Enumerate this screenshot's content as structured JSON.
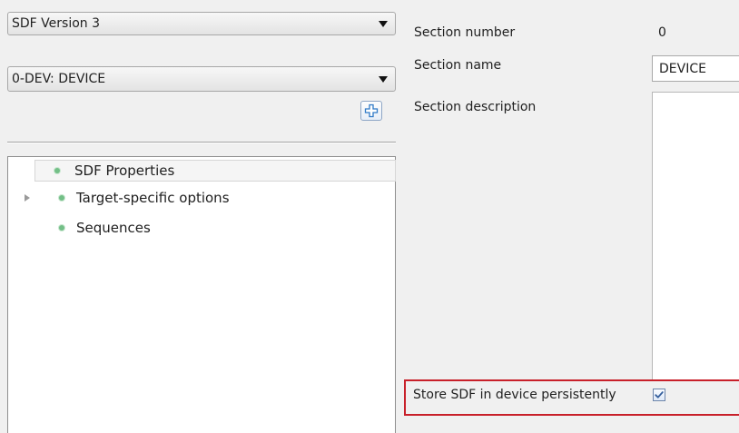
{
  "left_pane": {
    "version_combo": {
      "value": "SDF Version 3",
      "icon": "chevron-down-icon"
    },
    "section_combo": {
      "value": "0-DEV: DEVICE",
      "icon": "chevron-down-icon"
    },
    "add_button": {
      "icon": "plus-icon"
    },
    "tree": {
      "items": [
        {
          "label": "SDF Properties",
          "selected": true,
          "expandable": false,
          "icon": "green-dot-icon"
        },
        {
          "label": "Target-specific options",
          "selected": false,
          "expandable": true,
          "icon": "green-dot-icon"
        },
        {
          "label": "Sequences",
          "selected": false,
          "expandable": false,
          "icon": "green-dot-icon"
        }
      ]
    }
  },
  "right_pane": {
    "section_number": {
      "label": "Section number",
      "value": "0"
    },
    "section_name": {
      "label": "Section name",
      "value": "DEVICE"
    },
    "section_description": {
      "label": "Section description",
      "value": ""
    },
    "persist": {
      "label": "Store SDF in device persistently",
      "checked": true,
      "highlight_color": "#c8202a"
    }
  }
}
